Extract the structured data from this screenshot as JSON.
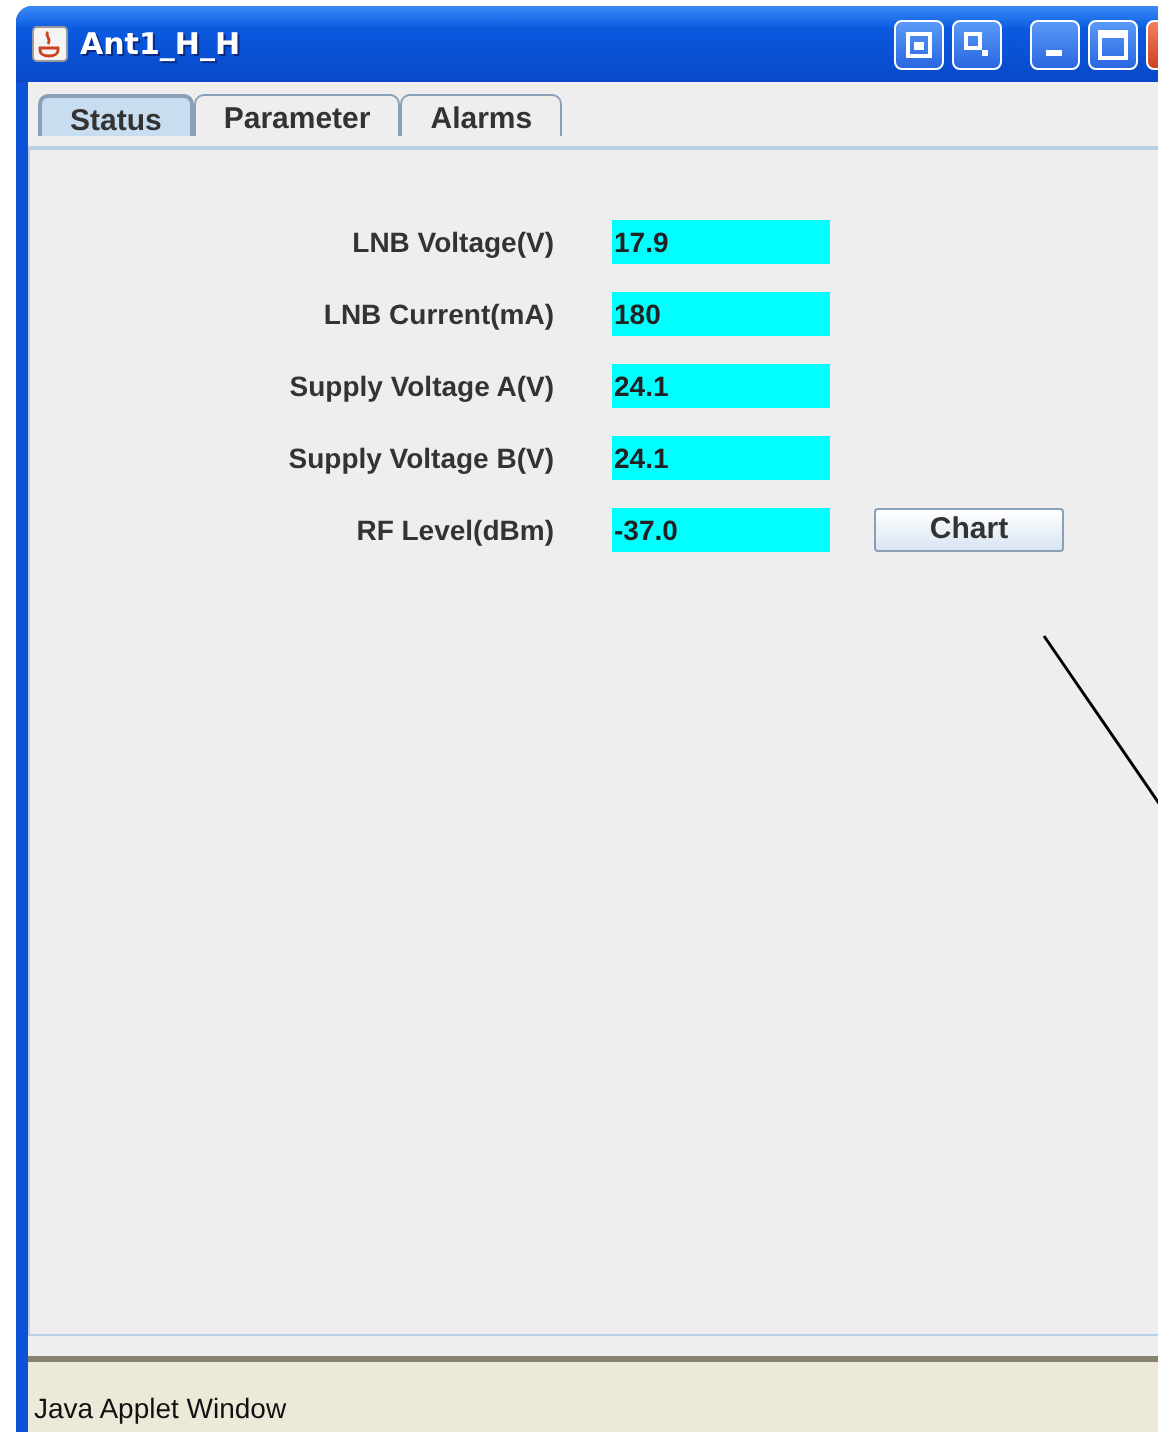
{
  "window": {
    "title": "Ant1_H_H"
  },
  "tabs": [
    {
      "label": "Status",
      "selected": true
    },
    {
      "label": "Parameter",
      "selected": false
    },
    {
      "label": "Alarms",
      "selected": false
    }
  ],
  "fields": [
    {
      "label": "LNB Voltage(V)",
      "value": "17.9"
    },
    {
      "label": "LNB Current(mA)",
      "value": "180"
    },
    {
      "label": "Supply Voltage A(V)",
      "value": "24.1"
    },
    {
      "label": "Supply Voltage B(V)",
      "value": "24.1"
    },
    {
      "label": "RF Level(dBm)",
      "value": "-37.0",
      "button": "Chart"
    }
  ],
  "status_bar": "Java Applet Window"
}
